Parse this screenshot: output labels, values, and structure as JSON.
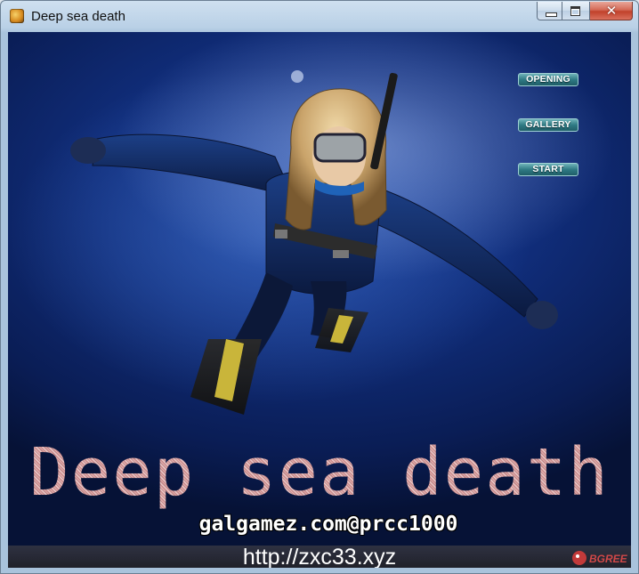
{
  "window": {
    "title": "Deep sea death",
    "icon": "game-app-icon",
    "controls": {
      "minimize_icon": "minimize-icon",
      "maximize_icon": "maximize-icon",
      "close_glyph": "✕"
    }
  },
  "menu": {
    "items": [
      {
        "label": "OPENING"
      },
      {
        "label": "GALLERY"
      },
      {
        "label": "START"
      }
    ]
  },
  "scene": {
    "title": "Deep sea death",
    "credit": "galgamez.com@prcc1000",
    "watermark_url": "http://zxc33.xyz",
    "corner_logo_text": "BGREE"
  },
  "colors": {
    "sea_dark": "#061236",
    "sea_mid": "#1a3f9c",
    "button_teal": "#2f7a84",
    "title_text": "#d9a2a2",
    "close_red": "#c1412b"
  }
}
